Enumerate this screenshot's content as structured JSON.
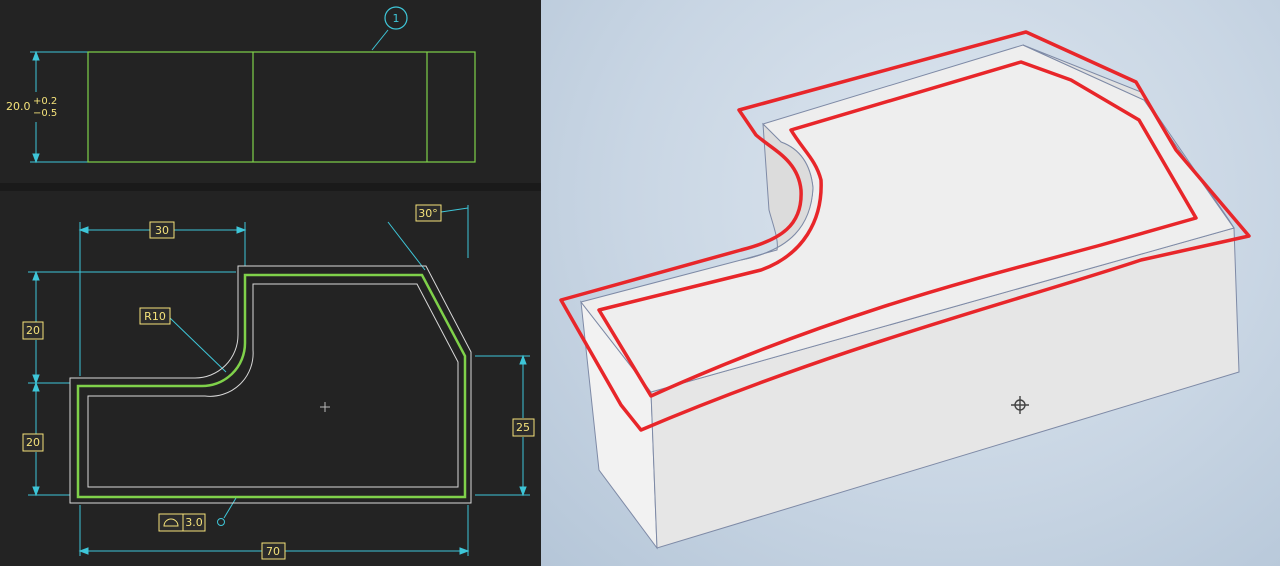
{
  "drawing": {
    "balloon": "1",
    "thickness": {
      "nominal": "20.0",
      "upper": "+0.2",
      "lower": "−0.5"
    },
    "dims": {
      "width_30": "30",
      "angle": "30°",
      "height_20_top": "20",
      "height_20_bottom": "20",
      "radius": "R10",
      "height_25": "25",
      "width_70": "70",
      "profile_value": "3.0"
    }
  },
  "model": {
    "origin_icon": "origin-triad-icon"
  },
  "colors": {
    "drawing_bg": "#232323",
    "part_green": "#7fd14a",
    "dim_cyan": "#3ec6d8",
    "label_yellow": "#f4e27a",
    "markup_red": "#e8262a"
  }
}
